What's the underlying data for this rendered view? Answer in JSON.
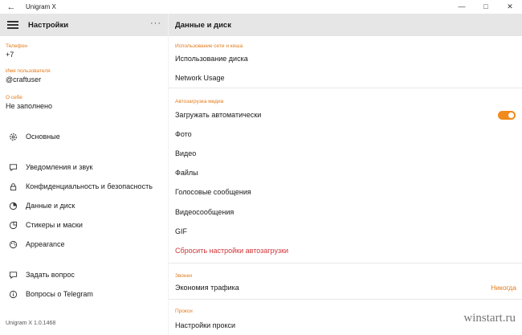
{
  "window": {
    "title": "Unigram X"
  },
  "left": {
    "title": "Настройки",
    "fields": [
      {
        "label": "Телефон",
        "value": "+7"
      },
      {
        "label": "Имя пользователя",
        "value": "@craftuser"
      },
      {
        "label": "О себе",
        "value": "Не заполнено"
      }
    ],
    "menu": [
      {
        "label": "Основные",
        "icon": "gear-icon"
      },
      {
        "label": "Уведомления и звук",
        "icon": "chat-icon"
      },
      {
        "label": "Конфиденциальность и безопасность",
        "icon": "lock-icon"
      },
      {
        "label": "Данные и диск",
        "icon": "pie-chart-icon"
      },
      {
        "label": "Стикеры и маски",
        "icon": "sticker-icon"
      },
      {
        "label": "Appearance",
        "icon": "palette-icon"
      },
      {
        "label": "Задать вопрос",
        "icon": "question-icon"
      },
      {
        "label": "Вопросы о Telegram",
        "icon": "info-icon"
      }
    ],
    "version": "Unigram X 1.0.1468"
  },
  "right": {
    "title": "Данные и диск",
    "sections": {
      "usage": "Использование сети и кеша",
      "autoload": "Автозагрузка медиа",
      "calls": "Звонки",
      "proxy": "Прокси"
    },
    "items": {
      "disk_usage": "Использование диска",
      "network_usage": "Network Usage",
      "auto_download": "Загружать автоматически",
      "photo": "Фото",
      "video": "Видео",
      "files": "Файлы",
      "voice": "Голосовые сообщения",
      "video_messages": "Видеосообщения",
      "gif": "GIF",
      "reset": "Сбросить настройки автозагрузки",
      "traffic_saving": "Экономия трафика",
      "traffic_value": "Никогда",
      "proxy_settings": "Настройки прокси"
    }
  },
  "watermark": "winstart.ru"
}
